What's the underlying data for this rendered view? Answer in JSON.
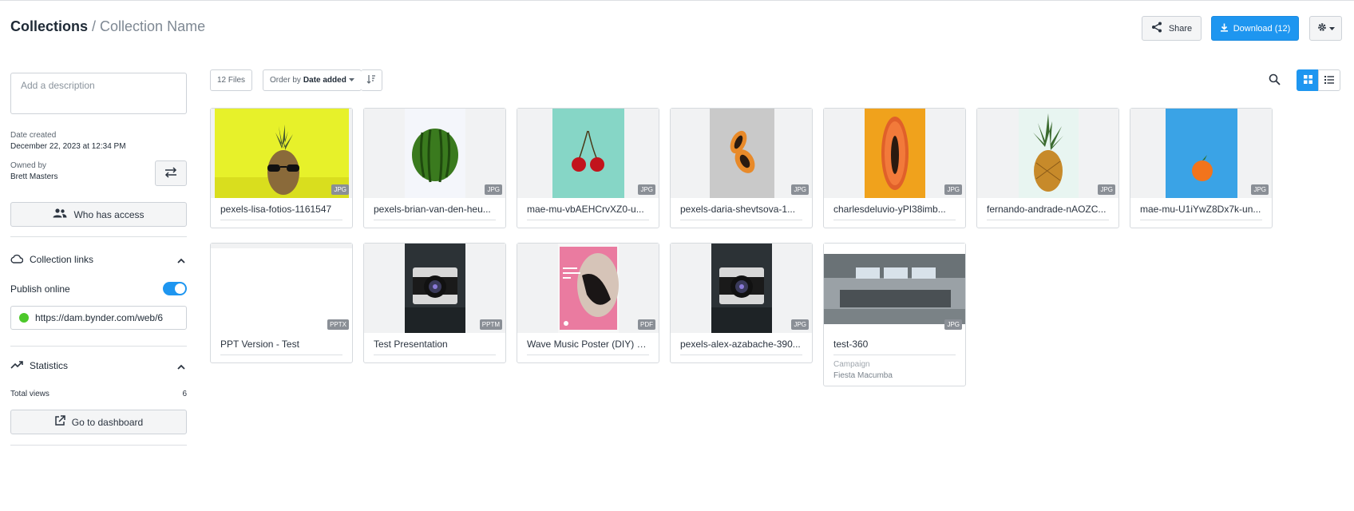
{
  "header": {
    "root": "Collections",
    "separator": "/",
    "collection_name": "Collection Name",
    "share_label": "Share",
    "download_label": "Download (12)"
  },
  "sidebar": {
    "description_placeholder": "Add a description",
    "date_created_label": "Date created",
    "date_created_value": "December 22, 2023 at 12:34 PM",
    "owned_by_label": "Owned by",
    "owned_by_value": "Brett Masters",
    "who_has_access_label": "Who has access",
    "collection_links_label": "Collection links",
    "publish_online_label": "Publish online",
    "publish_online_enabled": true,
    "public_link": "https://dam.bynder.com/web/6",
    "statistics_label": "Statistics",
    "total_views_label": "Total views",
    "total_views_value": "6",
    "dashboard_label": "Go to dashboard"
  },
  "toolbar": {
    "files_count": "12 Files",
    "order_prefix": "Order by",
    "order_value": "Date added"
  },
  "colors": {
    "accent": "#1e96f0",
    "toggle_on": "#1e96f0",
    "status_green": "#4cc82a"
  },
  "assets": [
    {
      "name": "pexels-lisa-fotios-1161547",
      "type": "JPG",
      "thumb": "pineapple-sunglasses"
    },
    {
      "name": "pexels-brian-van-den-heu...",
      "type": "JPG",
      "thumb": "watermelon"
    },
    {
      "name": "mae-mu-vbAEHCrvXZ0-u...",
      "type": "JPG",
      "thumb": "cherries"
    },
    {
      "name": "pexels-daria-shevtsova-1...",
      "type": "JPG",
      "thumb": "papaya-halves"
    },
    {
      "name": "charlesdeluvio-yPI38imb...",
      "type": "JPG",
      "thumb": "papaya-orange"
    },
    {
      "name": "fernando-andrade-nAOZC...",
      "type": "JPG",
      "thumb": "pineapple"
    },
    {
      "name": "mae-mu-U1iYwZ8Dx7k-un...",
      "type": "JPG",
      "thumb": "tangerine"
    },
    {
      "name": "PPT Version - Test",
      "type": "PPTX",
      "thumb": "blank"
    },
    {
      "name": "Test Presentation",
      "type": "PPTM",
      "thumb": "camera"
    },
    {
      "name": "Wave Music Poster (DIY) 2...",
      "type": "PDF",
      "thumb": "music-poster"
    },
    {
      "name": "pexels-alex-azabache-390...",
      "type": "JPG",
      "thumb": "camera"
    },
    {
      "name": "test-360",
      "type": "JPG",
      "thumb": "cockpit-360",
      "property_label": "Campaign",
      "property_value": "Fiesta Macumba"
    }
  ]
}
